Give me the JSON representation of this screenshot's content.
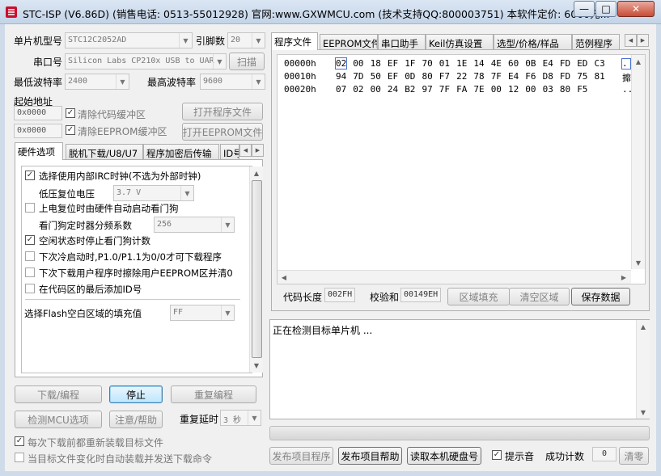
{
  "window": {
    "title": "STC-ISP (V6.86D) (销售电话: 0513-55012928) 官网:www.GXWMCU.com  (技术支持QQ:800003751) 本软件定价: 6000元...",
    "minimize": "—",
    "maximize": "□",
    "close": "✕"
  },
  "config": {
    "mcu_label": "单片机型号",
    "mcu_value": "STC12C2052AD",
    "pins_label": "引脚数",
    "pins_value": "20",
    "port_label": "串口号",
    "port_value": "Silicon Labs CP210x USB to UAR",
    "scan_button": "扫描",
    "min_baud_label": "最低波特率",
    "min_baud_value": "2400",
    "max_baud_label": "最高波特率",
    "max_baud_value": "9600",
    "start_addr_label": "起始地址",
    "code_addr": "0x0000",
    "clear_code_label": "清除代码缓冲区",
    "open_program_button": "打开程序文件",
    "eeprom_addr": "0x0000",
    "clear_eeprom_label": "清除EEPROM缓冲区",
    "open_eeprom_button": "打开EEPROM文件"
  },
  "left_tabs": [
    "硬件选项",
    "脱机下载/U8/U7",
    "程序加密后传输",
    "ID号"
  ],
  "hw_options": {
    "opt_irc": "选择使用内部IRC时钟(不选为外部时钟)",
    "low_volt_label": "低压复位电压",
    "low_volt_value": "3.7 V",
    "opt_watchdog": "上电复位时由硬件自动启动看门狗",
    "wdt_prescale_label": "看门狗定时器分频系数",
    "wdt_prescale_value": "256",
    "opt_idle_wdt": "空闲状态时停止看门狗计数",
    "opt_p10": "下次冷启动时,P1.0/P1.1为0/0才可下载程序",
    "opt_clear_eeprom": "下次下载用户程序时擦除用户EEPROM区并清0",
    "opt_add_id": "在代码区的最后添加ID号",
    "fill_label": "选择Flash空白区域的填充值",
    "fill_value": "FF"
  },
  "actions": {
    "download": "下载/编程",
    "stop": "停止",
    "reprogram": "重复编程",
    "check_mcu": "检测MCU选项",
    "help": "注意/帮助",
    "retry_delay_label": "重复延时",
    "retry_delay_value": "3 秒",
    "reload_before_download": "每次下载前都重新装载目标文件",
    "auto_download": "当目标文件变化时自动装载并发送下载命令"
  },
  "right_tabs": [
    "程序文件",
    "EEPROM文件",
    "串口助手",
    "Keil仿真设置",
    "选型/价格/样品",
    "范例程序"
  ],
  "hex_view": {
    "rows": [
      {
        "addr": "00000h",
        "bytes": [
          "02",
          "00",
          "18",
          "EF",
          "1F",
          "70",
          "01",
          "1E",
          "14",
          "4E",
          "60",
          "0B",
          "E4",
          "FD",
          "ED",
          "C3"
        ],
        "ascii": ". "
      },
      {
        "addr": "00010h",
        "bytes": [
          "94",
          "7D",
          "50",
          "EF",
          "0D",
          "80",
          "F7",
          "22",
          "78",
          "7F",
          "E4",
          "F6",
          "D8",
          "FD",
          "75",
          "81"
        ],
        "ascii": "攠"
      },
      {
        "addr": "00020h",
        "bytes": [
          "07",
          "02",
          "00",
          "24",
          "B2",
          "97",
          "7F",
          "FA",
          "7E",
          "00",
          "12",
          "00",
          "03",
          "80",
          "F5"
        ],
        "ascii": ".."
      }
    ]
  },
  "code_info": {
    "length_label": "代码长度",
    "length_value": "002FH",
    "checksum_label": "校验和",
    "checksum_value": "00149EH",
    "fill_area": "区域填充",
    "clear_area": "清空区域",
    "save_data": "保存数据"
  },
  "log": {
    "message": "正在检测目标单片机 ..."
  },
  "progress": {
    "fraction": 0
  },
  "bottom": {
    "publish_project": "发布项目程序",
    "publish_help": "发布项目帮助",
    "read_disk_id": "读取本机硬盘号",
    "beep_label": "提示音",
    "success_label": "成功计数",
    "success_value": "0",
    "clear_button": "清零"
  }
}
